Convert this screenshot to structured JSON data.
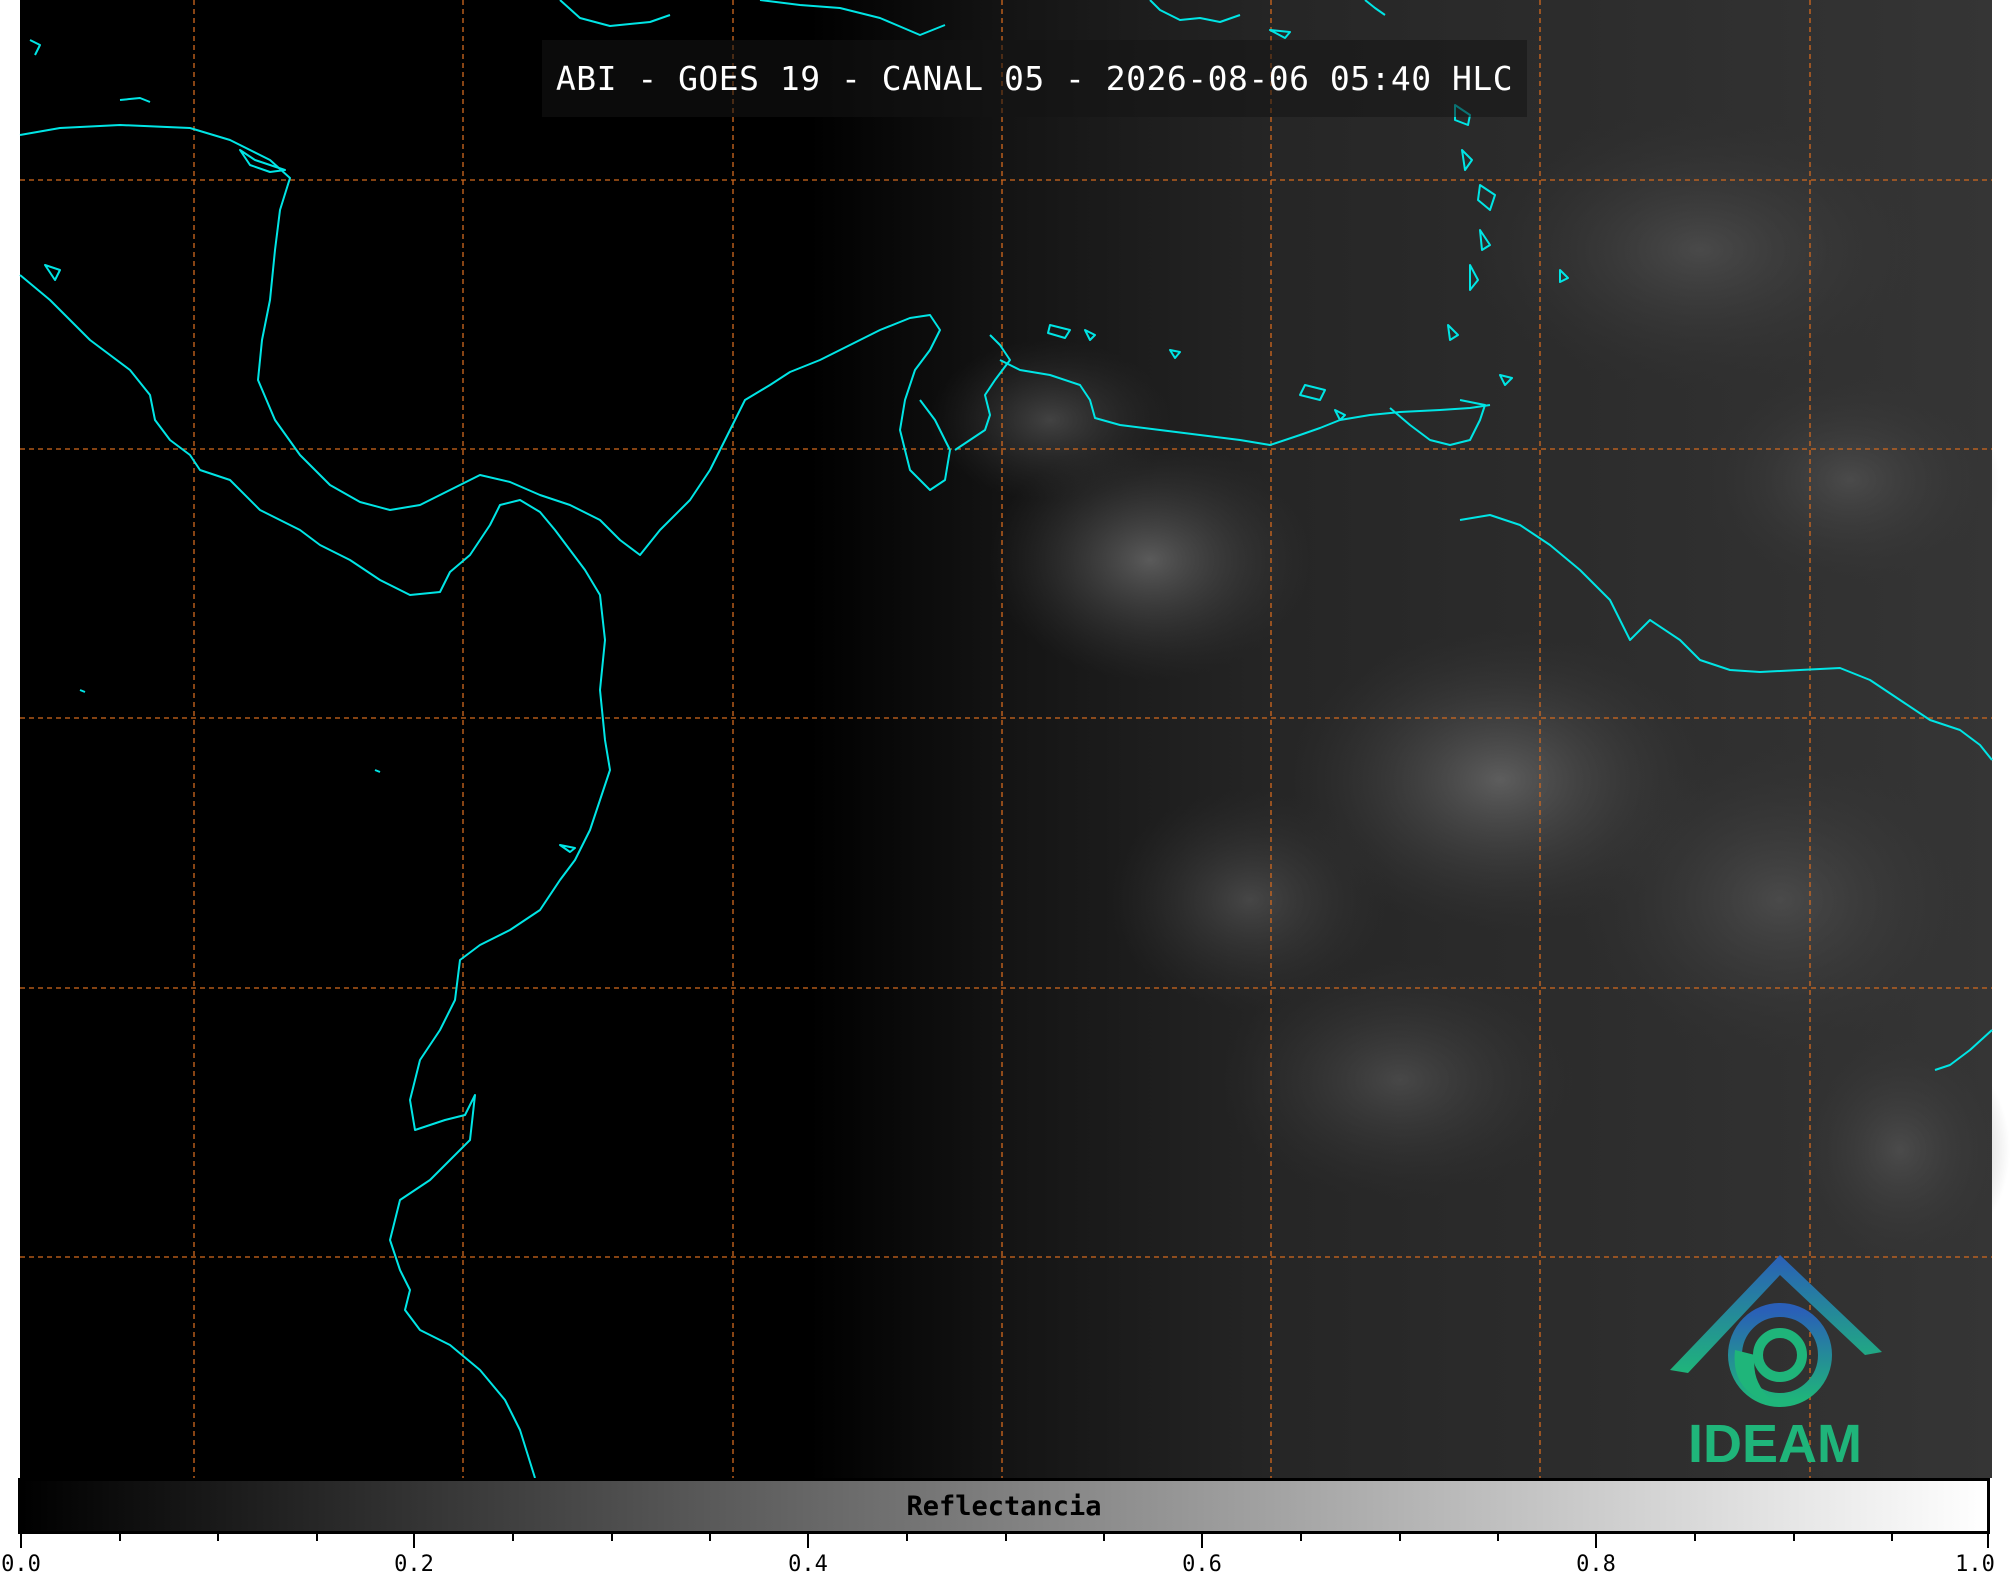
{
  "title": "ABI - GOES 19 - CANAL 05 - 2026-08-06 05:40 HLC",
  "colorbar": {
    "label": "Reflectancia",
    "ticks": [
      "0.0",
      "0.2",
      "0.4",
      "0.6",
      "0.8",
      "1.0"
    ],
    "min": 0.0,
    "max": 1.0,
    "colormap": [
      "#000000",
      "#ffffff"
    ]
  },
  "logo": {
    "text": "IDEAM",
    "icon": "ideam-logo-icon"
  },
  "colors": {
    "coastline": "#00e5e5",
    "gridlines": "#d2691e",
    "night_background": "#000000",
    "land_day": "#2a2a2a"
  }
}
